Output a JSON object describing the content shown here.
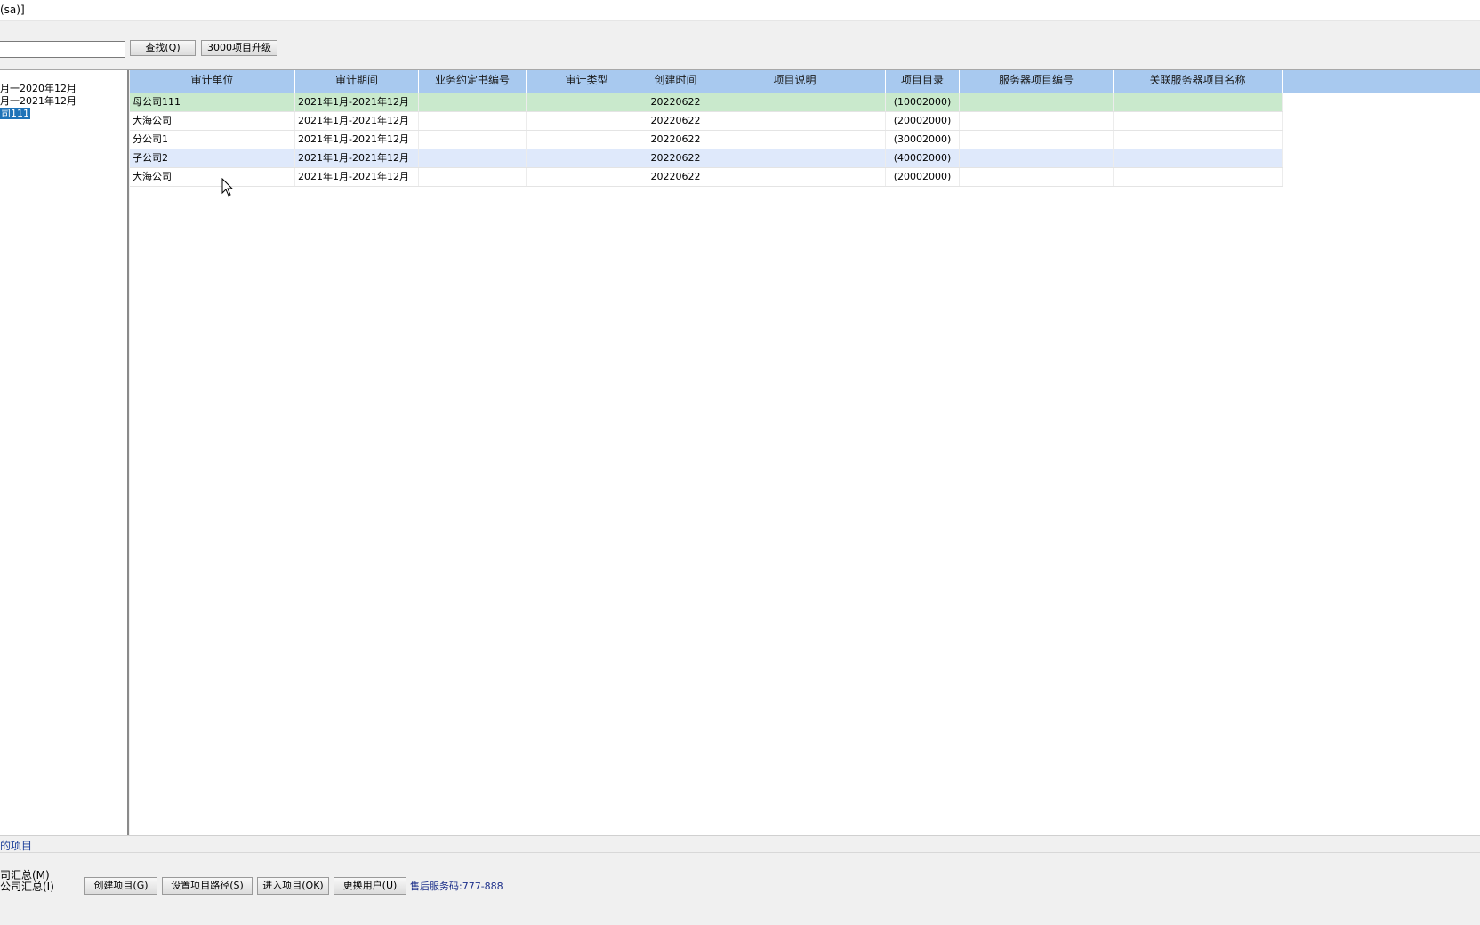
{
  "window": {
    "title": "(sa)]"
  },
  "toolbar": {
    "search_value": "",
    "find_label": "查找(Q)",
    "upgrade_label": "3000项目升级"
  },
  "tree": {
    "items": [
      {
        "label": "月一2020年12月",
        "selected": false
      },
      {
        "label": "月一2021年12月",
        "selected": false
      },
      {
        "label": "司111",
        "selected": true
      }
    ]
  },
  "table": {
    "columns": [
      "审计单位",
      "审计期间",
      "业务约定书编号",
      "审计类型",
      "创建时间",
      "项目说明",
      "项目目录",
      "服务器项目编号",
      "关联服务器项目名称"
    ],
    "rows": [
      {
        "unit": "母公司111",
        "period": "2021年1月-2021年12月",
        "contract": "",
        "type": "",
        "created": "20220622",
        "desc": "",
        "dir": "(10002000)",
        "server_no": "",
        "server_name": ""
      },
      {
        "unit": "大海公司",
        "period": "2021年1月-2021年12月",
        "contract": "",
        "type": "",
        "created": "20220622",
        "desc": "",
        "dir": "(20002000)",
        "server_no": "",
        "server_name": ""
      },
      {
        "unit": "分公司1",
        "period": "2021年1月-2021年12月",
        "contract": "",
        "type": "",
        "created": "20220622",
        "desc": "",
        "dir": "(30002000)",
        "server_no": "",
        "server_name": ""
      },
      {
        "unit": "子公司2",
        "period": "2021年1月-2021年12月",
        "contract": "",
        "type": "",
        "created": "20220622",
        "desc": "",
        "dir": "(40002000)",
        "server_no": "",
        "server_name": ""
      },
      {
        "unit": "大海公司",
        "period": "2021年1月-2021年12月",
        "contract": "",
        "type": "",
        "created": "20220622",
        "desc": "",
        "dir": "(20002000)",
        "server_no": "",
        "server_name": ""
      }
    ]
  },
  "status": {
    "text": "的项目"
  },
  "bottom": {
    "option1": "司汇总(M)",
    "option2": "公司汇总(I)",
    "create_label": "创建项目(G)",
    "set_path_label": "设置项目路径(S)",
    "enter_label": "进入项目(OK)",
    "change_user_label": "更换用户(U)",
    "service_code": "售后服务码:777-888"
  },
  "colors": {
    "header_bg": "#a8c9ef",
    "selected_row_bg": "#c9e9cc",
    "alt_row_bg": "#dfe9fb",
    "tree_selected_bg": "#1e73b8",
    "service_text": "#1c2f8a"
  },
  "icons": {
    "cursor": "mouse-pointer-icon"
  }
}
